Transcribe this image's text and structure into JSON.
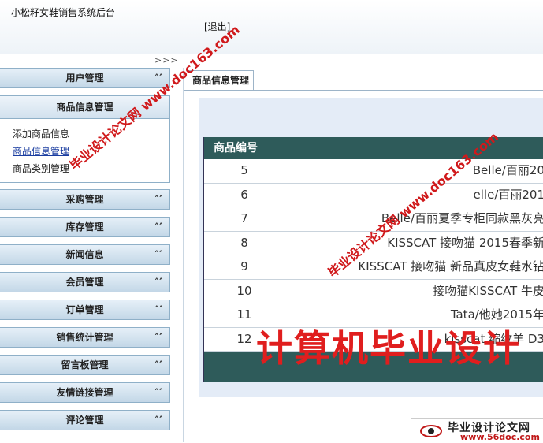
{
  "header": {
    "title": "小松籽女鞋销售系统后台",
    "logout": "[退出]"
  },
  "sidebar": {
    "toggle": ">>>",
    "menus_before": [
      {
        "label": "用户管理"
      }
    ],
    "open_menu": {
      "label": "商品信息管理",
      "items": [
        {
          "label": "添加商品信息"
        },
        {
          "label": "商品信息管理"
        },
        {
          "label": "商品类别管理"
        }
      ]
    },
    "menus_after": [
      {
        "label": "采购管理"
      },
      {
        "label": "库存管理"
      },
      {
        "label": "新闻信息"
      },
      {
        "label": "会员管理"
      },
      {
        "label": "订单管理"
      },
      {
        "label": "销售统计管理"
      },
      {
        "label": "留言板管理"
      },
      {
        "label": "友情链接管理"
      },
      {
        "label": "评论管理"
      }
    ]
  },
  "main": {
    "tab": "商品信息管理",
    "table": {
      "header": "商品编号",
      "rows": [
        {
          "id": "5",
          "name": "Belle/百丽20"
        },
        {
          "id": "6",
          "name": "elle/百丽201"
        },
        {
          "id": "7",
          "name": "Belle/百丽夏季专柜同款黑灰亮"
        },
        {
          "id": "8",
          "name": "KISSCAT 接吻猫 2015春季新"
        },
        {
          "id": "9",
          "name": "KISSCAT 接吻猫 新品真皮女鞋水钻"
        },
        {
          "id": "10",
          "name": "接吻猫KISSCAT 牛皮"
        },
        {
          "id": "11",
          "name": "Tata/他她2015年"
        },
        {
          "id": "12",
          "name": "kisscat 缩纹羊 D3"
        }
      ]
    }
  },
  "watermarks": {
    "big": "计算机毕业设计",
    "diag1": "毕业设计论文网 www.doc163.com",
    "diag2": "毕业设计论文网 www.doc163.com"
  },
  "footer_logo": {
    "title": "毕业设计论文网",
    "url": "www.56doc.com"
  }
}
